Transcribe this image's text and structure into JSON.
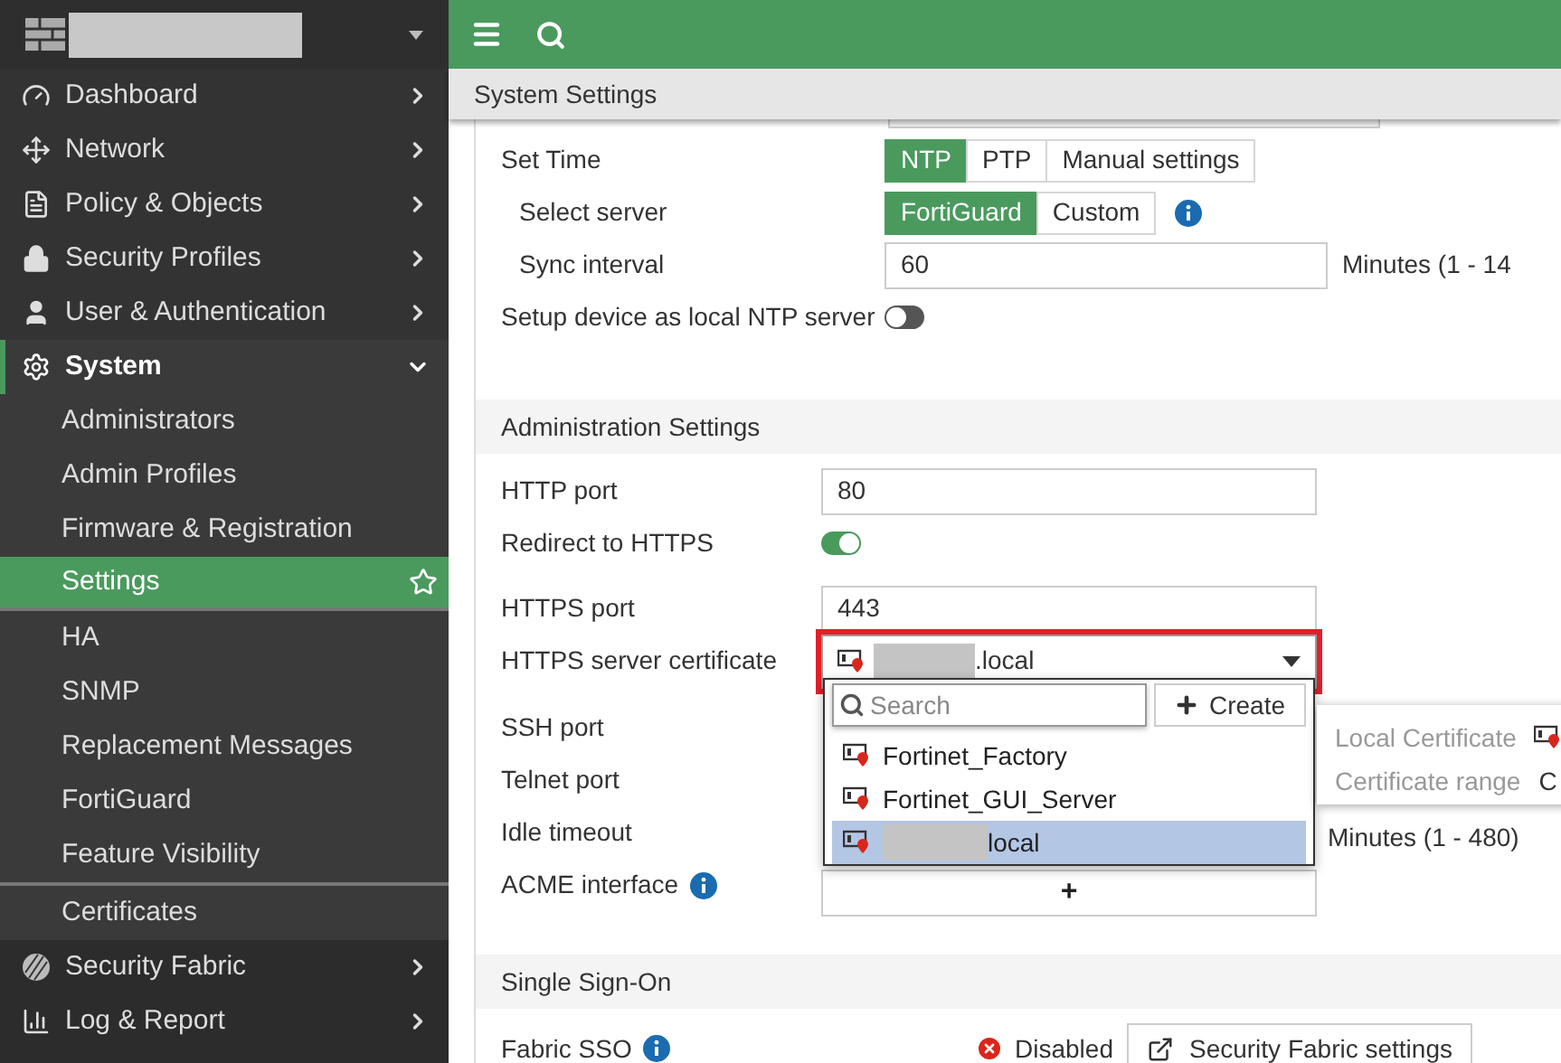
{
  "sidebar": {
    "items": [
      {
        "label": "Dashboard",
        "selected": false,
        "expanded": false
      },
      {
        "label": "Network",
        "selected": false,
        "expanded": false
      },
      {
        "label": "Policy & Objects",
        "selected": false,
        "expanded": false
      },
      {
        "label": "Security Profiles",
        "selected": false,
        "expanded": false
      },
      {
        "label": "User & Authentication",
        "selected": false,
        "expanded": false
      },
      {
        "label": "System",
        "selected": true,
        "expanded": true,
        "children": [
          {
            "label": "Administrators",
            "selected": false,
            "separated": false
          },
          {
            "label": "Admin Profiles",
            "selected": false,
            "separated": false
          },
          {
            "label": "Firmware & Registration",
            "selected": false,
            "separated": false
          },
          {
            "label": "Settings",
            "selected": true,
            "separated": false
          },
          {
            "label": "HA",
            "selected": false,
            "separated": false
          },
          {
            "label": "SNMP",
            "selected": false,
            "separated": false
          },
          {
            "label": "Replacement Messages",
            "selected": false,
            "separated": false
          },
          {
            "label": "FortiGuard",
            "selected": false,
            "separated": false
          },
          {
            "label": "Feature Visibility",
            "selected": false,
            "separated": false
          },
          {
            "label": "Certificates",
            "selected": false,
            "separated": true
          }
        ]
      },
      {
        "label": "Security Fabric",
        "selected": false,
        "expanded": false
      },
      {
        "label": "Log & Report",
        "selected": false,
        "expanded": false
      }
    ]
  },
  "page": {
    "title": "System Settings"
  },
  "sections": [
    {
      "rows": [
        {
          "kind": "segmented",
          "label": "Set Time",
          "options": [
            {
              "label": "NTP",
              "selected": true
            },
            {
              "label": "PTP",
              "selected": false
            },
            {
              "label": "Manual settings",
              "selected": false
            }
          ],
          "children": [
            {
              "kind": "segmented",
              "label": "Select server",
              "info": true,
              "options": [
                {
                  "label": "FortiGuard",
                  "selected": true
                },
                {
                  "label": "Custom",
                  "selected": false
                }
              ]
            },
            {
              "kind": "input",
              "label": "Sync interval",
              "value": "60",
              "suffix": "Minutes (1 - 14"
            }
          ]
        },
        {
          "kind": "toggle",
          "label": "Setup device as local NTP server",
          "on": false
        }
      ]
    },
    {
      "title": "Administration Settings",
      "rows": [
        {
          "kind": "input",
          "label": "HTTP port",
          "value": "80"
        },
        {
          "kind": "toggle",
          "label": "Redirect to HTTPS",
          "on": true
        },
        {
          "kind": "input",
          "label": "HTTPS port",
          "value": "443"
        },
        {
          "kind": "select",
          "label": "HTTPS server certificate",
          "value": ".local",
          "highlighted": true
        },
        {
          "kind": "label",
          "label": "SSH port"
        },
        {
          "kind": "label",
          "label": "Telnet port"
        },
        {
          "kind": "label",
          "label": "Idle timeout",
          "suffix": "Minutes (1 - 480)"
        },
        {
          "kind": "add",
          "label": "ACME interface",
          "info": true,
          "value": "+"
        }
      ]
    },
    {
      "title": "Single Sign-On",
      "rows": [
        {
          "kind": "status",
          "label": "Fabric SSO",
          "info": true,
          "status": "Disabled",
          "button": "Security Fabric settings"
        }
      ]
    }
  ],
  "dropdown": {
    "search_placeholder": "Search",
    "create_label": "Create",
    "options": [
      {
        "label": "Fortinet_Factory",
        "selected": false,
        "redacted": false
      },
      {
        "label": "Fortinet_GUI_Server",
        "selected": false,
        "redacted": false
      },
      {
        "label": "local",
        "selected": true,
        "redacted": true
      }
    ]
  },
  "tooltip": {
    "rows": [
      {
        "kind": "icon",
        "label": "Local Certificate"
      },
      {
        "kind": "text",
        "label": "Certificate range",
        "value": "C"
      }
    ]
  }
}
